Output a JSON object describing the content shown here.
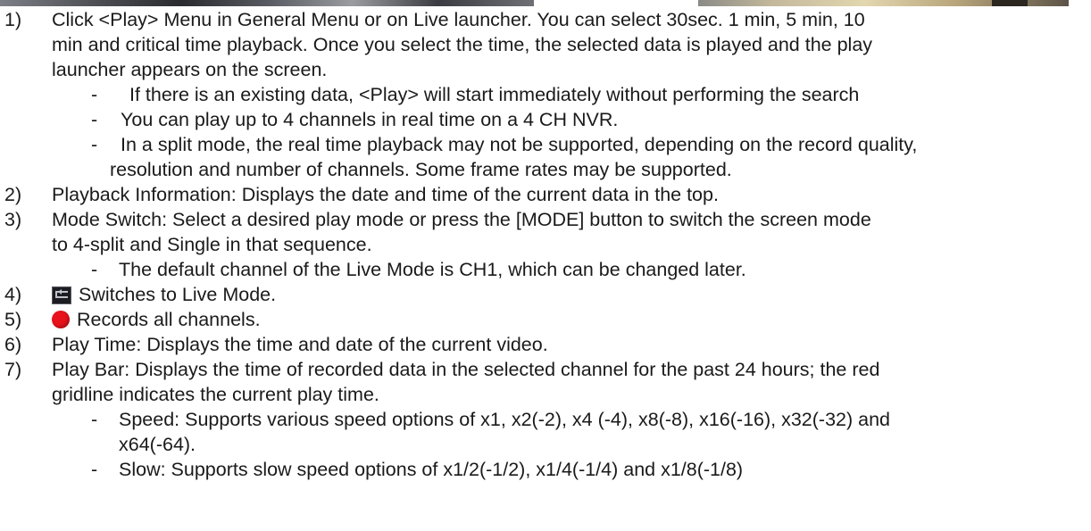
{
  "items": [
    {
      "num": "1)",
      "text": "Click <Play> Menu in General Menu or on Live launcher. You can select 30sec. 1 min, 5 min, 10",
      "cont": [
        "min and critical time playback. Once you select the time, the selected data is played and the play",
        "launcher appears on the screen."
      ],
      "subs": [
        {
          "text": "If there is an existing data, <Play> will start immediately without performing the search"
        },
        {
          "text": "You can play up to 4 channels in real time on a 4 CH NVR."
        },
        {
          "text": "In a split mode, the real time playback may not be supported, depending on the record quality,",
          "cont": "resolution and number of channels. Some frame rates may be supported."
        }
      ]
    },
    {
      "num": "2)",
      "text": "Playback Information: Displays the date and time of the current data in the top."
    },
    {
      "num": "3)",
      "text": "Mode Switch: Select a desired play mode or press the [MODE] button to switch the screen mode",
      "cont": [
        "to 4-split and Single in that sequence."
      ],
      "subs": [
        {
          "text": "The default channel of the Live Mode is CH1, which can be changed later."
        }
      ]
    },
    {
      "num": "4)",
      "icon": "live-mode-icon",
      "text": "Switches to Live Mode."
    },
    {
      "num": "5)",
      "icon": "record-icon",
      "text": "Records all channels."
    },
    {
      "num": "6)",
      "text": "Play Time: Displays the time and date of the current video."
    },
    {
      "num": "7)",
      "text": "Play Bar: Displays the time of recorded data in the selected channel for the past 24 hours; the red",
      "cont": [
        "gridline indicates the current play time."
      ],
      "subs": [
        {
          "text": "Speed: Supports various speed options of x1, x2(-2), x4 (-4), x8(-8), x16(-16), x32(-32) and",
          "cont": "x64(-64)."
        },
        {
          "text": "Slow: Supports slow speed options of x1/2(-1/2), x1/4(-1/4) and x1/8(-1/8)"
        }
      ]
    }
  ],
  "dash": "-"
}
